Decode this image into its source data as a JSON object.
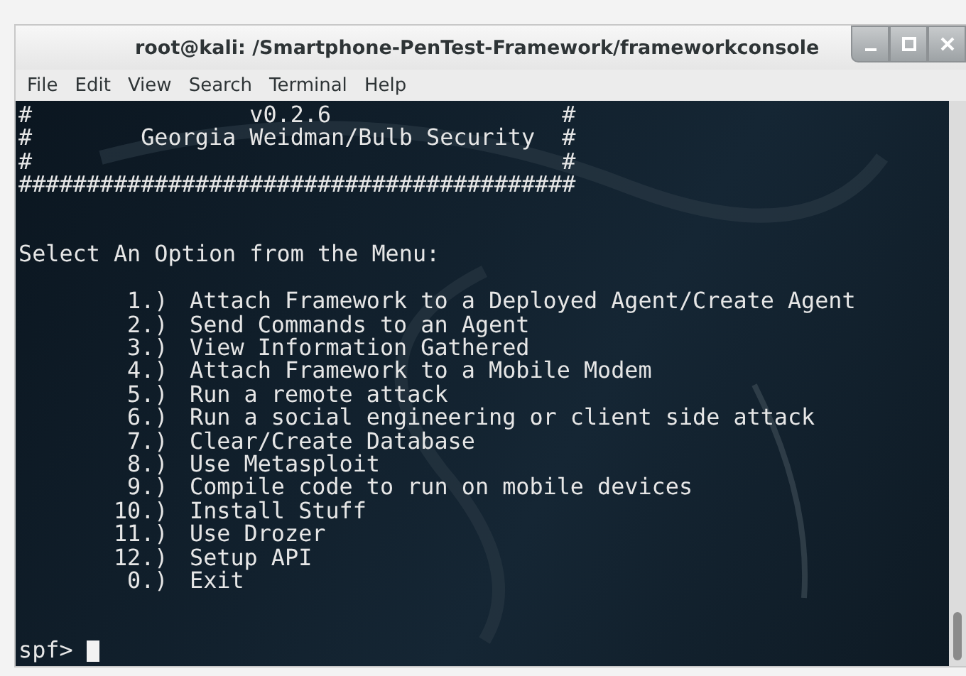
{
  "window": {
    "title": "root@kali: /Smartphone-PenTest-Framework/frameworkconsole"
  },
  "menu_bar": [
    "File",
    "Edit",
    "View",
    "Search",
    "Terminal",
    "Help"
  ],
  "terminal": {
    "header_lines": [
      "#                v0.2.6                 #",
      "#        Georgia Weidman/Bulb Security  #",
      "#                                       #",
      "#########################################"
    ],
    "menu_heading": "Select An Option from the Menu:",
    "menu_items": [
      {
        "number": "1.)",
        "label": "Attach Framework to a Deployed Agent/Create Agent"
      },
      {
        "number": "2.)",
        "label": "Send Commands to an Agent"
      },
      {
        "number": "3.)",
        "label": "View Information Gathered"
      },
      {
        "number": "4.)",
        "label": "Attach Framework to a Mobile Modem"
      },
      {
        "number": "5.)",
        "label": "Run a remote attack"
      },
      {
        "number": "6.)",
        "label": "Run a social engineering or client side attack"
      },
      {
        "number": "7.)",
        "label": "Clear/Create Database"
      },
      {
        "number": "8.)",
        "label": "Use Metasploit"
      },
      {
        "number": "9.)",
        "label": "Compile code to run on mobile devices"
      },
      {
        "number": "10.)",
        "label": "Install Stuff"
      },
      {
        "number": "11.)",
        "label": "Use Drozer"
      },
      {
        "number": "12.)",
        "label": "Setup API"
      },
      {
        "number": "0.)",
        "label": "Exit"
      }
    ],
    "prompt": "spf>"
  }
}
